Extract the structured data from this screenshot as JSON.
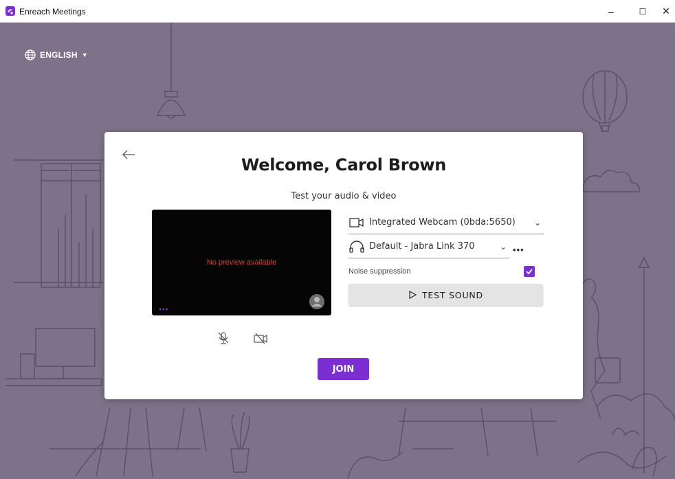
{
  "window": {
    "title": "Enreach Meetings",
    "minimize": "–",
    "maximize": "☐",
    "close": "✕",
    "accent_color": "#7b2fd1"
  },
  "language": {
    "label": "ENGLISH",
    "icon": "globe-icon"
  },
  "card": {
    "back_icon": "arrow-left-icon",
    "welcome": "Welcome, Carol Brown",
    "subtitle": "Test your audio & video",
    "preview": {
      "message": "No preview available",
      "more": "...",
      "avatar_icon": "avatar-icon"
    },
    "controls": {
      "mic_icon": "mic-off-icon",
      "camera_icon": "camera-off-icon"
    },
    "devices": {
      "camera": "Integrated Webcam (0bda:5650)",
      "audio": "Default - Jabra Link 370",
      "more": "•••"
    },
    "noise_suppression": {
      "label": "Noise suppression",
      "checked": true
    },
    "test_sound": "TEST SOUND",
    "join": "JOIN"
  }
}
